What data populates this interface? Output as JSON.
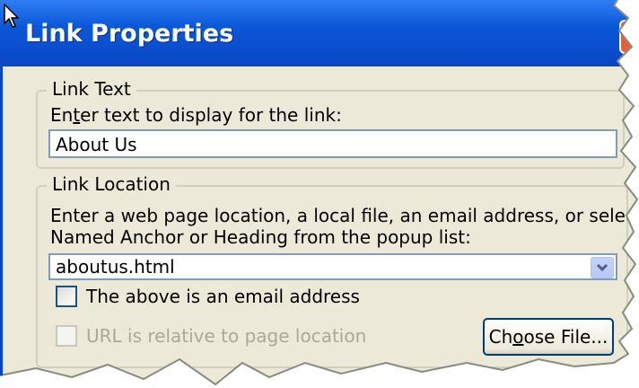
{
  "dialog": {
    "title": "Link Properties"
  },
  "link_text": {
    "group_label": "Link Text",
    "prompt_pre": "En",
    "prompt_key": "t",
    "prompt_post": "er text to display for the link:",
    "value": "About Us"
  },
  "link_location": {
    "group_label": "Link Location",
    "prompt_line1": "Enter a web page location, a local file, an email address, or select a",
    "prompt_line2": "Named Anchor or Heading from the popup list:",
    "url_value": "aboutus.html",
    "email_checkbox_label": "The above is an email address",
    "email_checked": false,
    "relative_checkbox_label": "URL is relative to page location",
    "relative_checked": false,
    "relative_enabled": false,
    "choose_file_pre": "Ch",
    "choose_file_key": "o",
    "choose_file_post": "ose File..."
  },
  "colors": {
    "title_bar": "#0a58d8",
    "dialog_bg": "#ece9d8",
    "field_border": "#7f9db9"
  }
}
